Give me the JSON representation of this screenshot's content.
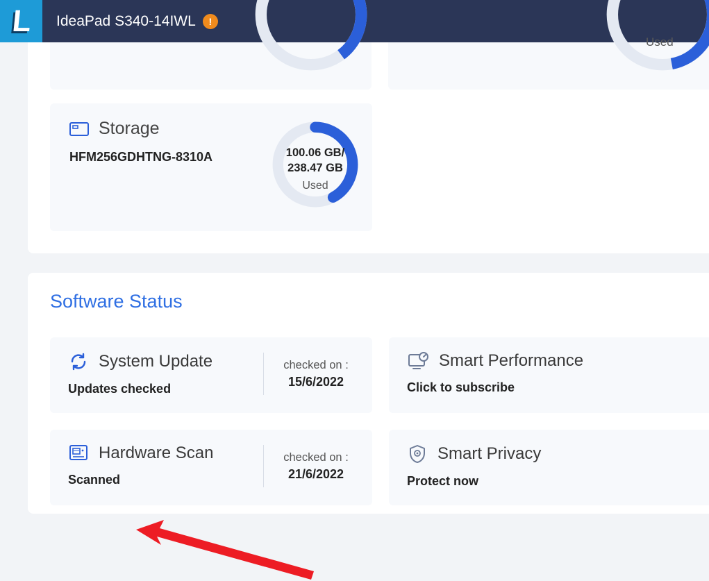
{
  "header": {
    "logo_letter": "L",
    "device_name": "IdeaPad S340-14IWL",
    "alert_symbol": "!"
  },
  "hardware": {
    "partial_right_ring_label": "Used",
    "storage": {
      "title": "Storage",
      "model": "HFM256GDHTNG-8310A",
      "used_gb": "100.06 GB/",
      "total_gb": "238.47 GB",
      "used_label": "Used"
    }
  },
  "software_status": {
    "title": "Software Status",
    "cards": {
      "system_update": {
        "title": "System Update",
        "status": "Updates checked",
        "meta_label": "checked on :",
        "meta_value": "15/6/2022"
      },
      "smart_performance": {
        "title": "Smart Performance",
        "status": "Click to subscribe"
      },
      "hardware_scan": {
        "title": "Hardware Scan",
        "status": "Scanned",
        "meta_label": "checked on :",
        "meta_value": "21/6/2022"
      },
      "smart_privacy": {
        "title": "Smart Privacy",
        "status": "Protect now"
      }
    }
  }
}
